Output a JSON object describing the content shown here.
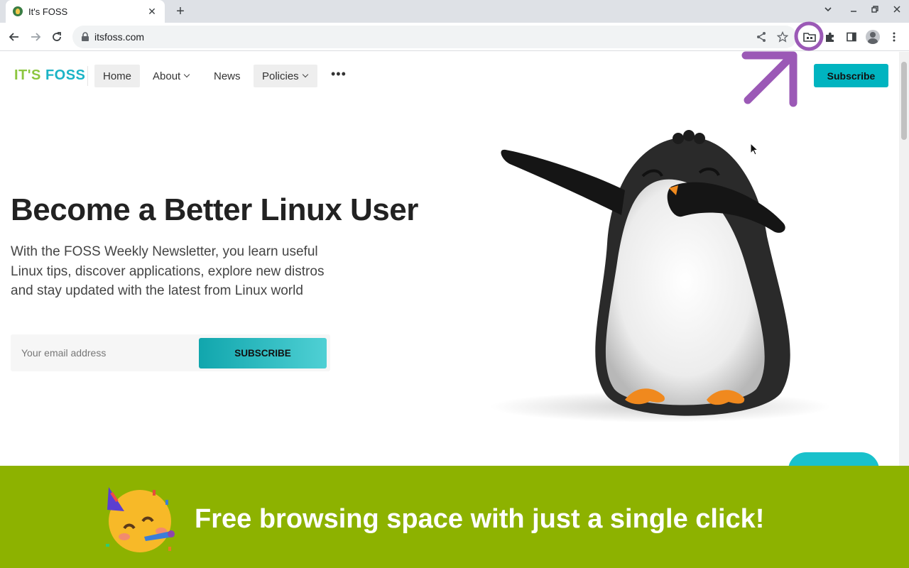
{
  "browser": {
    "tab_title": "It's FOSS",
    "new_tab": "+",
    "url": "itsfoss.com"
  },
  "site": {
    "logo_part1": "IT'S ",
    "logo_part2": "FOSS",
    "nav": {
      "home": "Home",
      "about": "About",
      "news": "News",
      "policies": "Policies"
    },
    "subscribe_label": "Subscribe",
    "hero_title": "Become a Better Linux User",
    "hero_text": "With the FOSS Weekly Newsletter, you learn useful Linux tips, discover applications, explore new distros and stay updated with the latest from Linux world",
    "email_placeholder": "Your email address",
    "subscribe_button": "SUBSCRIBE"
  },
  "banner": {
    "text": "Free browsing space with just a single click!"
  },
  "colors": {
    "accent": "#00b4c0",
    "banner_bg": "#8db200",
    "annotation": "#9b59b6"
  }
}
